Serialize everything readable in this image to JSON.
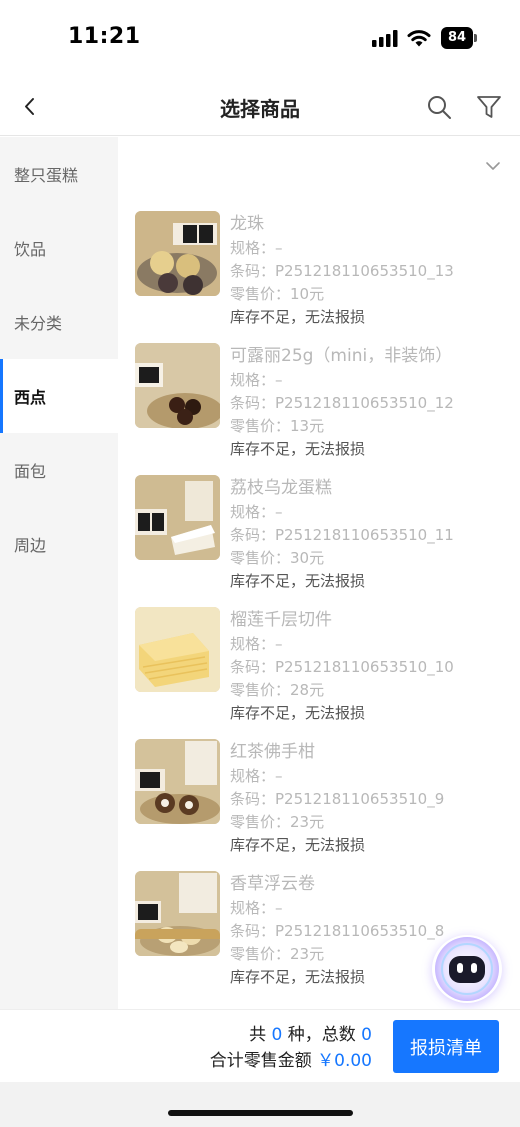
{
  "status_bar": {
    "time": "11:21",
    "battery": "84"
  },
  "nav": {
    "title": "选择商品"
  },
  "sidebar": {
    "items": [
      {
        "label": "整只蛋糕"
      },
      {
        "label": "饮品"
      },
      {
        "label": "未分类"
      },
      {
        "label": "西点",
        "active": true
      },
      {
        "label": "面包"
      },
      {
        "label": "周边"
      }
    ]
  },
  "products": [
    {
      "name": "龙珠",
      "spec": "规格：–",
      "barcode": "条码：P251218110653510_13",
      "price": "零售价：10元",
      "warning": "库存不足，无法报损"
    },
    {
      "name": "可露丽25g（mini，非装饰）",
      "spec": "规格：–",
      "barcode": "条码：P251218110653510_12",
      "price": "零售价：13元",
      "warning": "库存不足，无法报损"
    },
    {
      "name": "荔枝乌龙蛋糕",
      "spec": "规格：–",
      "barcode": "条码：P251218110653510_11",
      "price": "零售价：30元",
      "warning": "库存不足，无法报损"
    },
    {
      "name": "榴莲千层切件",
      "spec": "规格：–",
      "barcode": "条码：P251218110653510_10",
      "price": "零售价：28元",
      "warning": "库存不足，无法报损"
    },
    {
      "name": "红茶佛手柑",
      "spec": "规格：–",
      "barcode": "条码：P251218110653510_9",
      "price": "零售价：23元",
      "warning": "库存不足，无法报损"
    },
    {
      "name": "香草浮云卷",
      "spec": "规格：–",
      "barcode": "条码：P251218110653510_8",
      "price": "零售价：23元",
      "warning": "库存不足，无法报损"
    }
  ],
  "footer": {
    "prefix_total": "共",
    "kinds": "0",
    "kinds_suffix": "种，总数",
    "count": "0",
    "amount_label": "合计零售金额",
    "amount": "￥0.00",
    "submit_label": "报损清单"
  },
  "colors": {
    "accent": "#1677ff",
    "muted_text": "#b8b8b8",
    "sidebar_bg": "#f5f5f5"
  }
}
